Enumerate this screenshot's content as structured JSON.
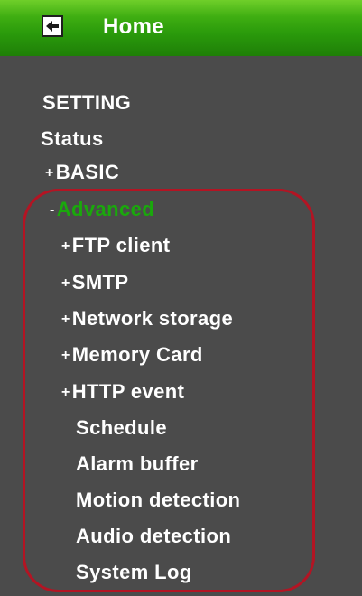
{
  "header": {
    "home_label": "Home"
  },
  "menu": {
    "setting": "SETTING",
    "status": "Status",
    "basic": {
      "prefix": "+",
      "label": "BASIC"
    },
    "advanced": {
      "prefix": "-",
      "label": "Advanced",
      "color": "#1aa80c"
    },
    "advanced_items": [
      {
        "prefix": "+",
        "label": "FTP client"
      },
      {
        "prefix": "+",
        "label": "SMTP"
      },
      {
        "prefix": "+",
        "label": "Network storage"
      },
      {
        "prefix": "+",
        "label": "Memory Card"
      },
      {
        "prefix": "+",
        "label": "HTTP event"
      },
      {
        "prefix": "",
        "label": "Schedule"
      },
      {
        "prefix": "",
        "label": "Alarm buffer"
      },
      {
        "prefix": "",
        "label": "Motion detection"
      },
      {
        "prefix": "",
        "label": "Audio detection"
      },
      {
        "prefix": "",
        "label": "System Log"
      }
    ]
  },
  "colors": {
    "background": "#4b4b4b",
    "header_green": "#2a9a0b",
    "highlight_outline": "#b31423",
    "text": "#ffffff"
  },
  "icons": {
    "home": "back-arrow-icon"
  }
}
